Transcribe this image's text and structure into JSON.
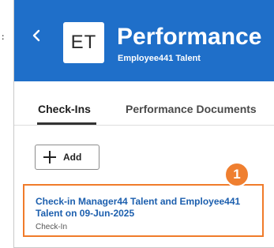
{
  "header": {
    "back_icon": "chevron-left-icon",
    "avatar_initials": "ET",
    "title": "Performance",
    "subtitle": "Employee441 Talent",
    "background_color": "#1f6fc9"
  },
  "tabs": [
    {
      "label": "Check-Ins",
      "selected": true
    },
    {
      "label": "Performance Documents",
      "selected": false
    }
  ],
  "toolbar": {
    "add_icon": "plus-icon",
    "add_label": "Add"
  },
  "checkins": [
    {
      "title": "Check-in Manager44 Talent and Employee441 Talent on 09-Jun-2025",
      "type": "Check-In"
    }
  ],
  "callout": {
    "number": "1",
    "color": "#ef7f30"
  }
}
